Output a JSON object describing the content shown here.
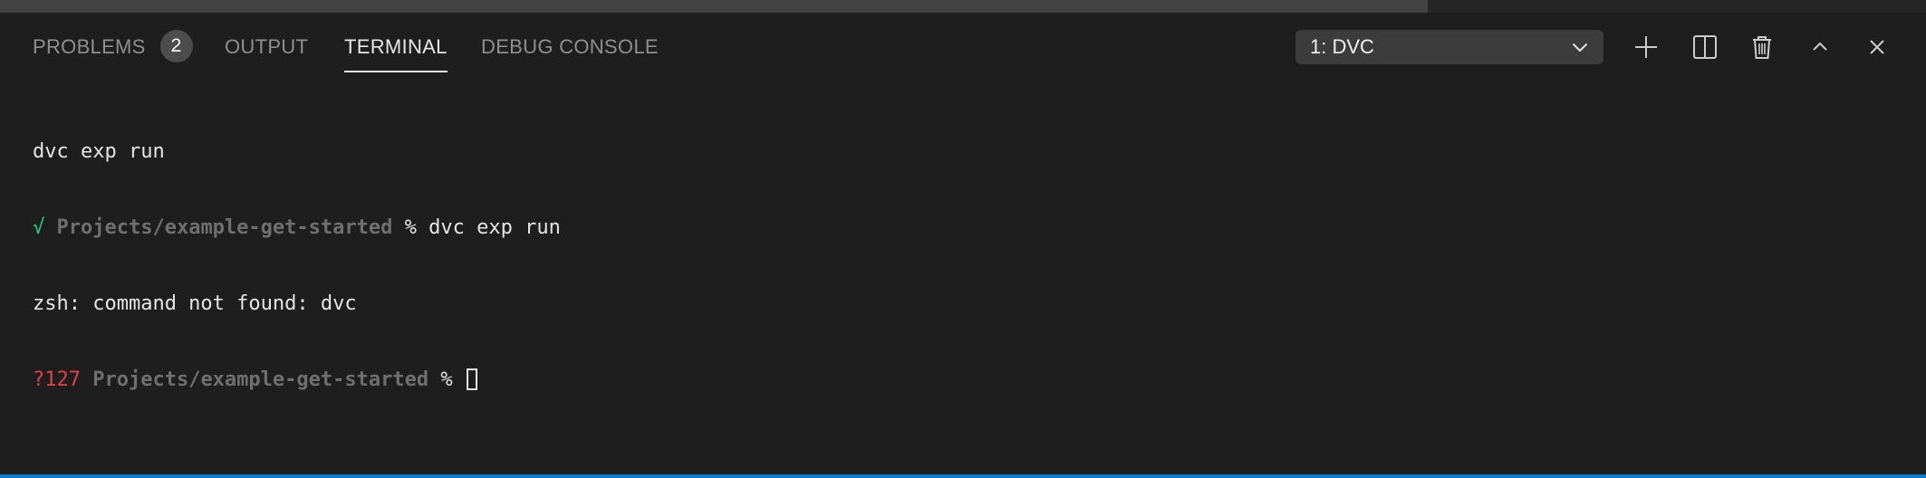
{
  "panel": {
    "tabs": [
      {
        "label": "PROBLEMS",
        "badge": "2"
      },
      {
        "label": "OUTPUT"
      },
      {
        "label": "TERMINAL",
        "active": true
      },
      {
        "label": "DEBUG CONSOLE"
      }
    ],
    "terminal_selector": {
      "value": "1: DVC"
    },
    "actions": [
      "plus-icon",
      "split-icon",
      "trash-icon",
      "chevron-up-icon",
      "close-icon"
    ]
  },
  "terminal": {
    "lines": [
      {
        "text": "dvc exp run"
      },
      {
        "status": "√",
        "path": "Projects/example-get-started",
        "prompt": "%",
        "command": "dvc exp run"
      },
      {
        "text": "zsh: command not found: dvc"
      },
      {
        "status": "?127",
        "path": "Projects/example-get-started",
        "prompt": "%"
      }
    ]
  },
  "colors": {
    "background": "#1e1e1e",
    "success": "#23d18b",
    "error": "#e24141",
    "accent_bar": "#0a7acc"
  }
}
